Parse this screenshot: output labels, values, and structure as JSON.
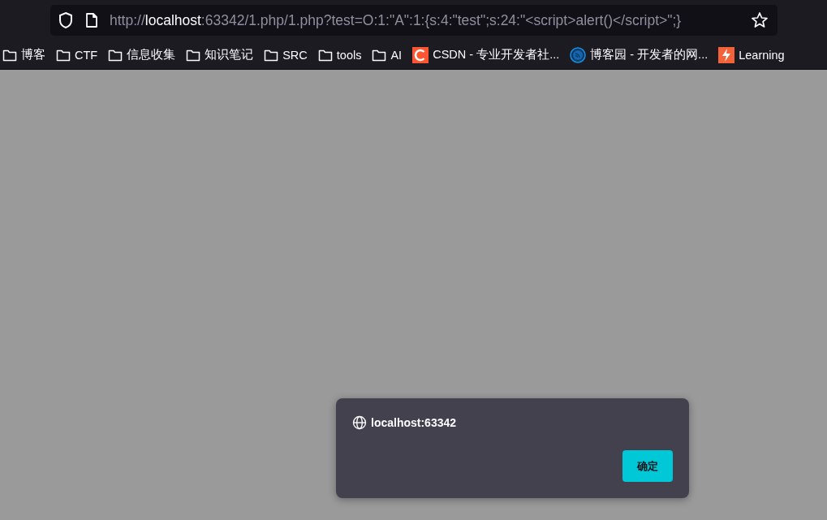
{
  "address_bar": {
    "url_scheme": "http://",
    "url_host": "localhost",
    "url_rest": ":63342/1.php/1.php?test=O:1:\"A\":1:{s:4:\"test\";s:24:\"<script>alert()</script>\";}"
  },
  "bookmarks": [
    {
      "kind": "folder",
      "label": "博客"
    },
    {
      "kind": "folder",
      "label": "CTF"
    },
    {
      "kind": "folder",
      "label": "信息收集"
    },
    {
      "kind": "folder",
      "label": "知识笔记"
    },
    {
      "kind": "folder",
      "label": "SRC"
    },
    {
      "kind": "folder",
      "label": "tools"
    },
    {
      "kind": "folder",
      "label": "AI"
    },
    {
      "kind": "arc-site",
      "label": "CSDN - 专业开发者社..."
    },
    {
      "kind": "feed-site",
      "label": "博客园 - 开发者的网..."
    },
    {
      "kind": "bolt-site",
      "label": "Learning"
    }
  ],
  "dialog": {
    "origin": "localhost:63342",
    "button": "确定"
  }
}
